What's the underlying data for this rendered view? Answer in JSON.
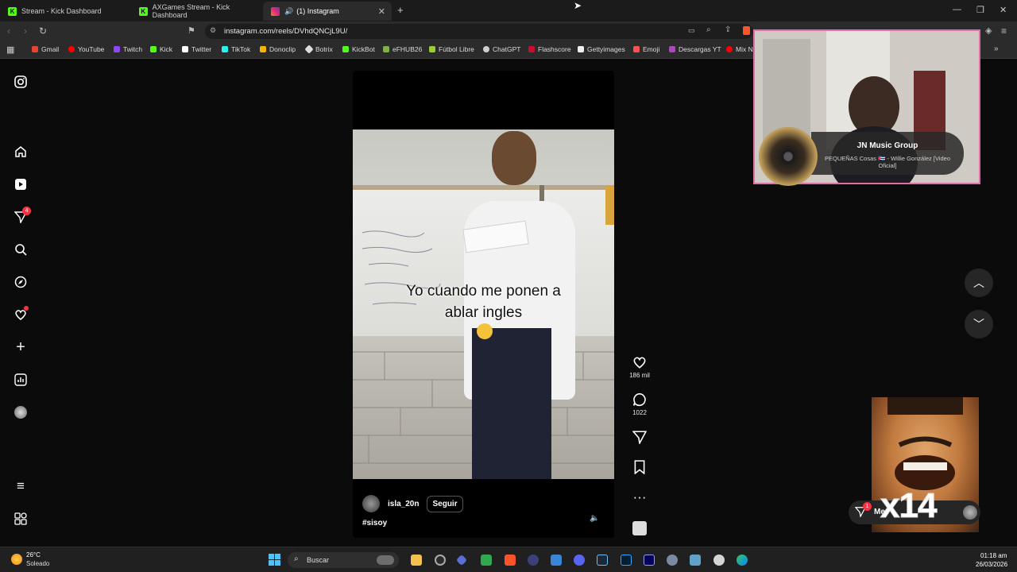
{
  "browser": {
    "tabs": [
      {
        "label": "Stream - Kick Dashboard"
      },
      {
        "label": "AXGames Stream - Kick Dashboard"
      },
      {
        "label": "(1) Instagram"
      }
    ],
    "url": "instagram.com/reels/DVhdQNCjL9U/",
    "bookmarks": [
      "Gmail",
      "YouTube",
      "Twitch",
      "Kick",
      "Twitter",
      "TikTok",
      "Donoclip",
      "Botrix",
      "KickBot",
      "eFHUB26",
      "Fútbol Libre",
      "ChatGPT",
      "Flashscore",
      "Gettyimages",
      "Emoji",
      "Descargas YT",
      "Mix N"
    ]
  },
  "sidebar": {
    "notifications_badge": "4"
  },
  "reel": {
    "caption_line1": "Yo cuando me ponen a",
    "caption_line2": "ablar ingles",
    "username": "isla_20n",
    "follow_label": "Seguir",
    "hashtag": "#sisoy",
    "likes": "186 mil",
    "comments": "1022"
  },
  "now_playing": {
    "artist": "JN Music Group",
    "song": "PEQUEÑAS Cosas 🇨🇺 - Willie González [Video Oficial]"
  },
  "meme": {
    "label": "x14"
  },
  "messages": {
    "label": "Me",
    "badge": "1"
  },
  "taskbar": {
    "temperature": "26°C",
    "weather": "Soleado",
    "search_label": "Buscar",
    "time": "01:18 am",
    "date": "26/03/2026"
  },
  "colors": {
    "accent_badge": "#ff3040",
    "webcam_border": "#e06fa8",
    "background": "#0b0b0b"
  }
}
